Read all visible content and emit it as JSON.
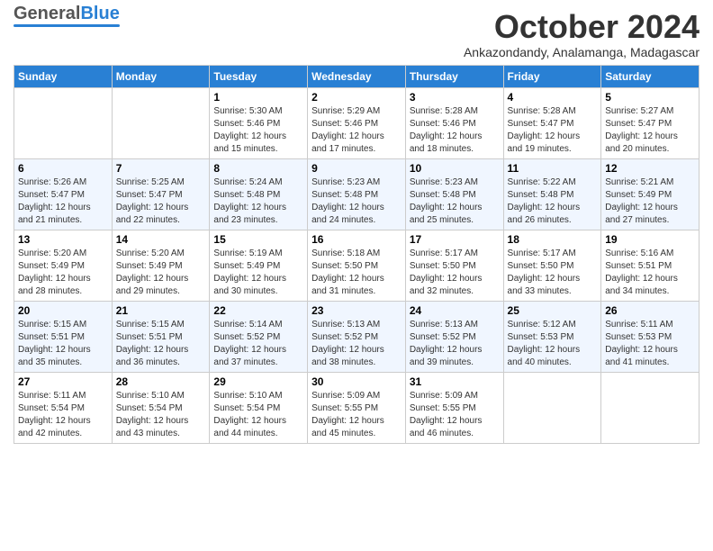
{
  "header": {
    "logo": {
      "part1": "General",
      "part2": "Blue"
    },
    "month": "October 2024",
    "location": "Ankazondandy, Analamanga, Madagascar"
  },
  "weekdays": [
    "Sunday",
    "Monday",
    "Tuesday",
    "Wednesday",
    "Thursday",
    "Friday",
    "Saturday"
  ],
  "weeks": [
    [
      {
        "day": "",
        "info": ""
      },
      {
        "day": "",
        "info": ""
      },
      {
        "day": "1",
        "info": "Sunrise: 5:30 AM\nSunset: 5:46 PM\nDaylight: 12 hours and 15 minutes."
      },
      {
        "day": "2",
        "info": "Sunrise: 5:29 AM\nSunset: 5:46 PM\nDaylight: 12 hours and 17 minutes."
      },
      {
        "day": "3",
        "info": "Sunrise: 5:28 AM\nSunset: 5:46 PM\nDaylight: 12 hours and 18 minutes."
      },
      {
        "day": "4",
        "info": "Sunrise: 5:28 AM\nSunset: 5:47 PM\nDaylight: 12 hours and 19 minutes."
      },
      {
        "day": "5",
        "info": "Sunrise: 5:27 AM\nSunset: 5:47 PM\nDaylight: 12 hours and 20 minutes."
      }
    ],
    [
      {
        "day": "6",
        "info": "Sunrise: 5:26 AM\nSunset: 5:47 PM\nDaylight: 12 hours and 21 minutes."
      },
      {
        "day": "7",
        "info": "Sunrise: 5:25 AM\nSunset: 5:47 PM\nDaylight: 12 hours and 22 minutes."
      },
      {
        "day": "8",
        "info": "Sunrise: 5:24 AM\nSunset: 5:48 PM\nDaylight: 12 hours and 23 minutes."
      },
      {
        "day": "9",
        "info": "Sunrise: 5:23 AM\nSunset: 5:48 PM\nDaylight: 12 hours and 24 minutes."
      },
      {
        "day": "10",
        "info": "Sunrise: 5:23 AM\nSunset: 5:48 PM\nDaylight: 12 hours and 25 minutes."
      },
      {
        "day": "11",
        "info": "Sunrise: 5:22 AM\nSunset: 5:48 PM\nDaylight: 12 hours and 26 minutes."
      },
      {
        "day": "12",
        "info": "Sunrise: 5:21 AM\nSunset: 5:49 PM\nDaylight: 12 hours and 27 minutes."
      }
    ],
    [
      {
        "day": "13",
        "info": "Sunrise: 5:20 AM\nSunset: 5:49 PM\nDaylight: 12 hours and 28 minutes."
      },
      {
        "day": "14",
        "info": "Sunrise: 5:20 AM\nSunset: 5:49 PM\nDaylight: 12 hours and 29 minutes."
      },
      {
        "day": "15",
        "info": "Sunrise: 5:19 AM\nSunset: 5:49 PM\nDaylight: 12 hours and 30 minutes."
      },
      {
        "day": "16",
        "info": "Sunrise: 5:18 AM\nSunset: 5:50 PM\nDaylight: 12 hours and 31 minutes."
      },
      {
        "day": "17",
        "info": "Sunrise: 5:17 AM\nSunset: 5:50 PM\nDaylight: 12 hours and 32 minutes."
      },
      {
        "day": "18",
        "info": "Sunrise: 5:17 AM\nSunset: 5:50 PM\nDaylight: 12 hours and 33 minutes."
      },
      {
        "day": "19",
        "info": "Sunrise: 5:16 AM\nSunset: 5:51 PM\nDaylight: 12 hours and 34 minutes."
      }
    ],
    [
      {
        "day": "20",
        "info": "Sunrise: 5:15 AM\nSunset: 5:51 PM\nDaylight: 12 hours and 35 minutes."
      },
      {
        "day": "21",
        "info": "Sunrise: 5:15 AM\nSunset: 5:51 PM\nDaylight: 12 hours and 36 minutes."
      },
      {
        "day": "22",
        "info": "Sunrise: 5:14 AM\nSunset: 5:52 PM\nDaylight: 12 hours and 37 minutes."
      },
      {
        "day": "23",
        "info": "Sunrise: 5:13 AM\nSunset: 5:52 PM\nDaylight: 12 hours and 38 minutes."
      },
      {
        "day": "24",
        "info": "Sunrise: 5:13 AM\nSunset: 5:52 PM\nDaylight: 12 hours and 39 minutes."
      },
      {
        "day": "25",
        "info": "Sunrise: 5:12 AM\nSunset: 5:53 PM\nDaylight: 12 hours and 40 minutes."
      },
      {
        "day": "26",
        "info": "Sunrise: 5:11 AM\nSunset: 5:53 PM\nDaylight: 12 hours and 41 minutes."
      }
    ],
    [
      {
        "day": "27",
        "info": "Sunrise: 5:11 AM\nSunset: 5:54 PM\nDaylight: 12 hours and 42 minutes."
      },
      {
        "day": "28",
        "info": "Sunrise: 5:10 AM\nSunset: 5:54 PM\nDaylight: 12 hours and 43 minutes."
      },
      {
        "day": "29",
        "info": "Sunrise: 5:10 AM\nSunset: 5:54 PM\nDaylight: 12 hours and 44 minutes."
      },
      {
        "day": "30",
        "info": "Sunrise: 5:09 AM\nSunset: 5:55 PM\nDaylight: 12 hours and 45 minutes."
      },
      {
        "day": "31",
        "info": "Sunrise: 5:09 AM\nSunset: 5:55 PM\nDaylight: 12 hours and 46 minutes."
      },
      {
        "day": "",
        "info": ""
      },
      {
        "day": "",
        "info": ""
      }
    ]
  ]
}
